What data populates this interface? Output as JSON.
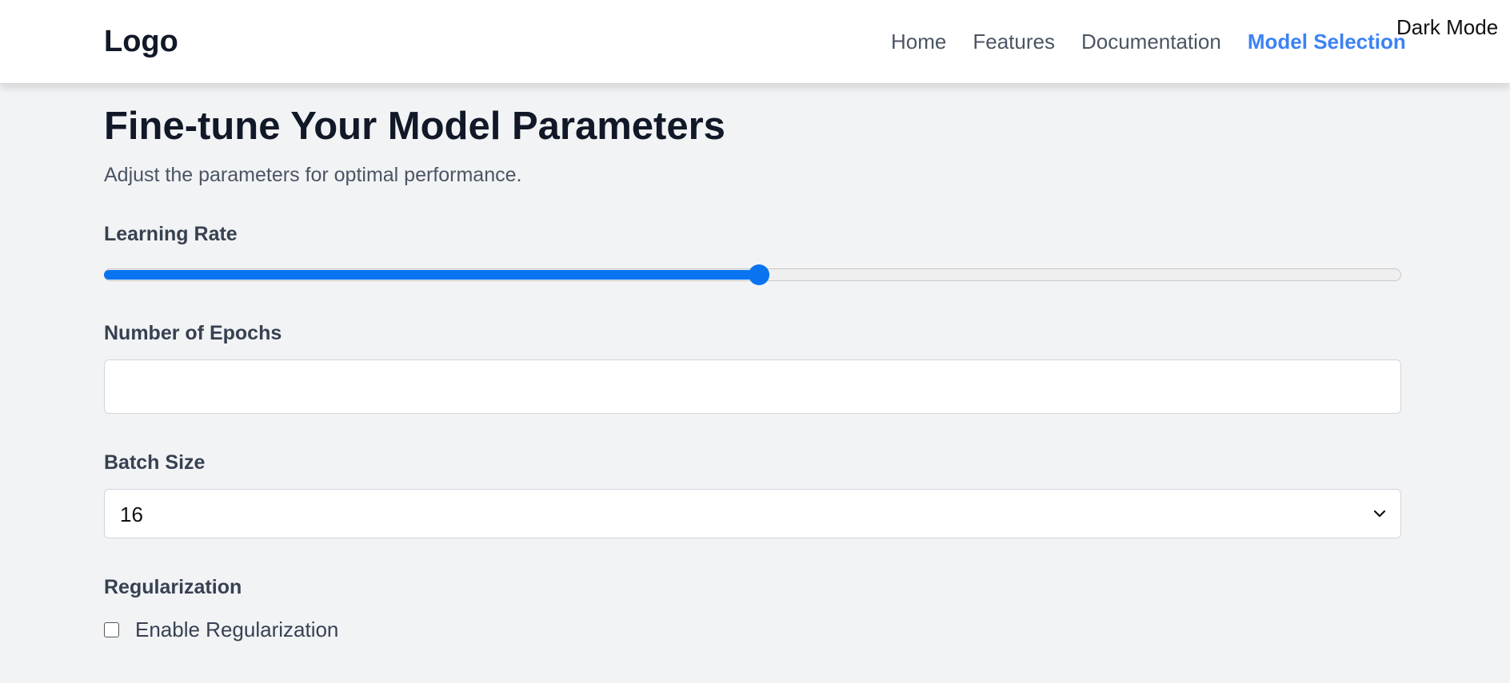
{
  "header": {
    "logo": "Logo",
    "nav": [
      {
        "label": "Home",
        "active": false
      },
      {
        "label": "Features",
        "active": false
      },
      {
        "label": "Documentation",
        "active": false
      },
      {
        "label": "Model Selection",
        "active": true
      }
    ],
    "dark_mode_label": "Dark Mode"
  },
  "main": {
    "title": "Fine-tune Your Model Parameters",
    "subtitle": "Adjust the parameters for optimal performance."
  },
  "learning_rate": {
    "label": "Learning Rate",
    "value_fraction": 0.505
  },
  "epochs": {
    "label": "Number of Epochs",
    "value": "",
    "placeholder": ""
  },
  "batch_size": {
    "label": "Batch Size",
    "selected": "16",
    "icon": "chevron-down-icon"
  },
  "regularization": {
    "label": "Regularization",
    "checkbox_label": "Enable Regularization",
    "checked": false
  },
  "colors": {
    "accent": "#0a74f0",
    "nav_active": "#3b82f6",
    "background": "#f2f3f5"
  }
}
